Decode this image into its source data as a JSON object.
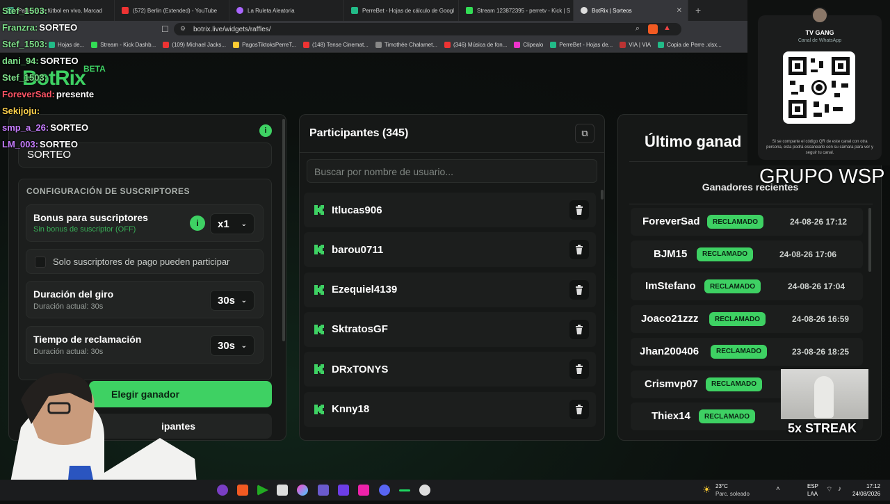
{
  "browser": {
    "tabs": [
      {
        "label": "Partidos de fútbol en vivo, Marcad",
        "color": "#4a8"
      },
      {
        "label": "(572) Berlin (Extended) - YouTube",
        "color": "#e33"
      },
      {
        "label": "La Ruleta Aleatoria",
        "color": "#a6f"
      },
      {
        "label": "PerreBet - Hojas de cálculo de Googl",
        "color": "#2b8"
      },
      {
        "label": "Stream 123872395 - perretv - Kick | S",
        "color": "#3d5"
      },
      {
        "label": "BotRix | Sorteos",
        "color": "#ddd",
        "active": true
      }
    ],
    "url": "botrix.live/widgets/raffles/",
    "bookmarks": [
      "Hojas de...",
      "Stream - Kick Dashb...",
      "(109) Michael Jacks...",
      "PagosTiktoksPerreT...",
      "(148) Tense Cinemat...",
      "Timothée Chalamet...",
      "(346) Música de fon...",
      "Clipealo",
      "PerreBet - Hojas de...",
      "VIA | VIA",
      "Copia de Perre .xlsx..."
    ]
  },
  "app": {
    "logo": "BotRix",
    "badge": "BETA"
  },
  "left_panel": {
    "keyword_value": "SORTEO",
    "section_title": "CONFIGURACIÓN DE SUSCRIPTORES",
    "bonus": {
      "title": "Bonus para suscriptores",
      "subtitle": "Sin bonus de suscriptor (OFF)",
      "value": "x1"
    },
    "only_paid": "Solo suscriptores de pago pueden participar",
    "spin": {
      "title": "Duración del giro",
      "subtitle": "Duración actual: 30s",
      "value": "30s"
    },
    "claim": {
      "title": "Tiempo de reclamación",
      "subtitle": "Duración actual: 30s",
      "value": "30s"
    },
    "pick_button": "Elegir ganador",
    "second_button": "ipantes"
  },
  "participants": {
    "title": "Participantes (345)",
    "search_placeholder": "Buscar por nombre de usuario...",
    "items": [
      "Itlucas906",
      "barou0711",
      "Ezequiel4139",
      "SktratosGF",
      "DRxTONYS",
      "Knny18"
    ]
  },
  "winners": {
    "title": "Último ganad",
    "recent_title": "Ganadores recientes",
    "items": [
      {
        "name": "ForeverSad",
        "status": "RECLAMADO",
        "date": "24-08-26 17:12"
      },
      {
        "name": "BJM15",
        "status": "RECLAMADO",
        "date": "24-08-26 17:06"
      },
      {
        "name": "ImStefano",
        "status": "RECLAMADO",
        "date": "24-08-26 17:04"
      },
      {
        "name": "Joaco21zzz",
        "status": "RECLAMADO",
        "date": "24-08-26 16:59"
      },
      {
        "name": "Jhan200406",
        "status": "RECLAMADO",
        "date": "23-08-26 18:25"
      },
      {
        "name": "Crismvp07",
        "status": "RECLAMADO",
        "date": ""
      },
      {
        "name": "Thiex14",
        "status": "RECLAMADO",
        "date": ""
      }
    ]
  },
  "chat": [
    {
      "user": "Stef_1503:",
      "msg": "",
      "color": "#7ee08a"
    },
    {
      "user": "Franzra:",
      "msg": "SORTEO",
      "color": "#7ee08a"
    },
    {
      "user": "Stef_1503:",
      "msg": "",
      "color": "#7ee08a"
    },
    {
      "user": "dani_94:",
      "msg": "SORTEO",
      "color": "#7ee08a"
    },
    {
      "user": "Stef_1503:",
      "msg": "",
      "color": "#7ee08a"
    },
    {
      "user": "ForeverSad:",
      "msg": "presente",
      "color": "#ff5566"
    },
    {
      "user": "Sekijoju:",
      "msg": "",
      "color": "#ffd24d"
    },
    {
      "user": "smp_a_26:",
      "msg": "SORTEO",
      "color": "#c77dff"
    },
    {
      "user": "LM_003:",
      "msg": "SORTEO",
      "color": "#c77dff"
    }
  ],
  "overlay": {
    "qr_title": "TV GANG",
    "qr_sub": "Canal de WhatsApp",
    "qr_note": "Si se comparte el código QR de este canal con otra persona, esta podrá escanearlo con su cámara para ver y seguir tu canal.",
    "grupo": "GRUPO WSP",
    "streak": "5x STREAK"
  },
  "taskbar": {
    "weather_temp": "23°C",
    "weather_desc": "Parc. soleado",
    "lang1": "ESP",
    "lang2": "LAA",
    "time": "17:12",
    "date": "24/08/2026"
  },
  "colors": {
    "accent": "#3ed163",
    "bg": "#0d0f0e",
    "panel": "#161817"
  }
}
